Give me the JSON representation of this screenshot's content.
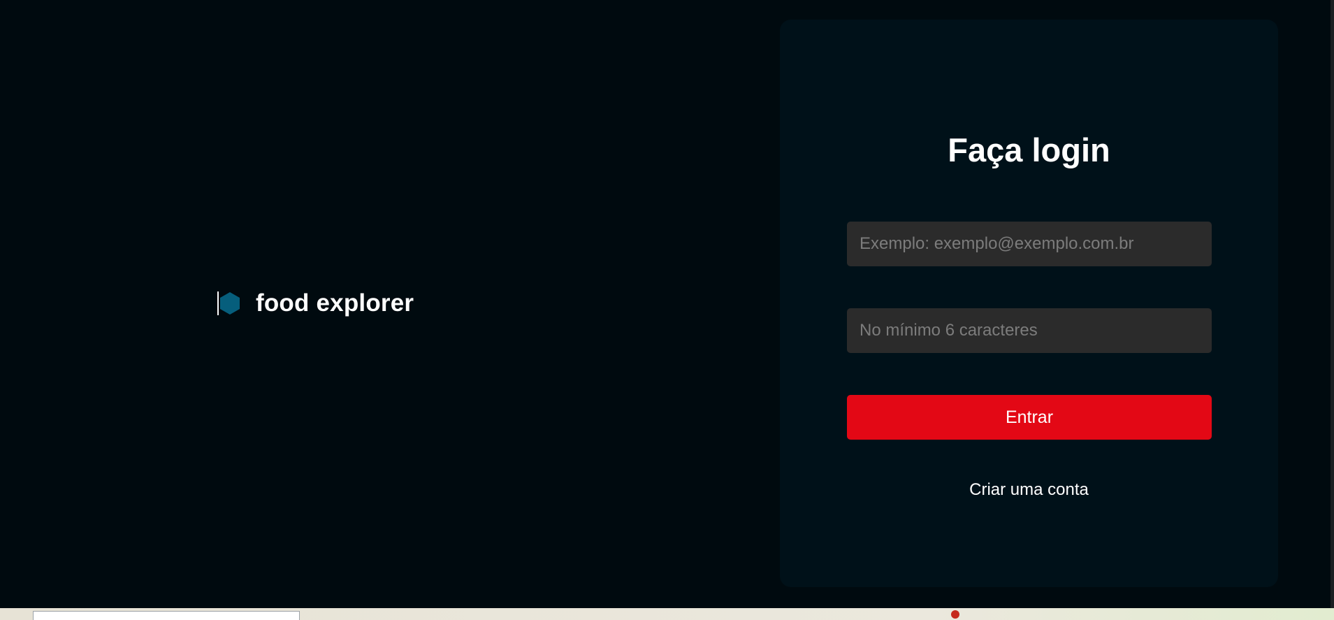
{
  "brand": {
    "name": "food explorer",
    "icon": "hexagon-logo-icon",
    "icon_color": "#065e7c"
  },
  "login": {
    "title": "Faça login",
    "email_placeholder": "Exemplo: exemplo@exemplo.com.br",
    "email_value": "",
    "password_placeholder": "No mínimo 6 caracteres",
    "password_value": "",
    "submit_label": "Entrar",
    "signup_label": "Criar uma conta"
  },
  "colors": {
    "background": "#000a0f",
    "card": "#001119",
    "input": "#2b2b2b",
    "accent": "#e30815",
    "text": "#ffffff"
  }
}
